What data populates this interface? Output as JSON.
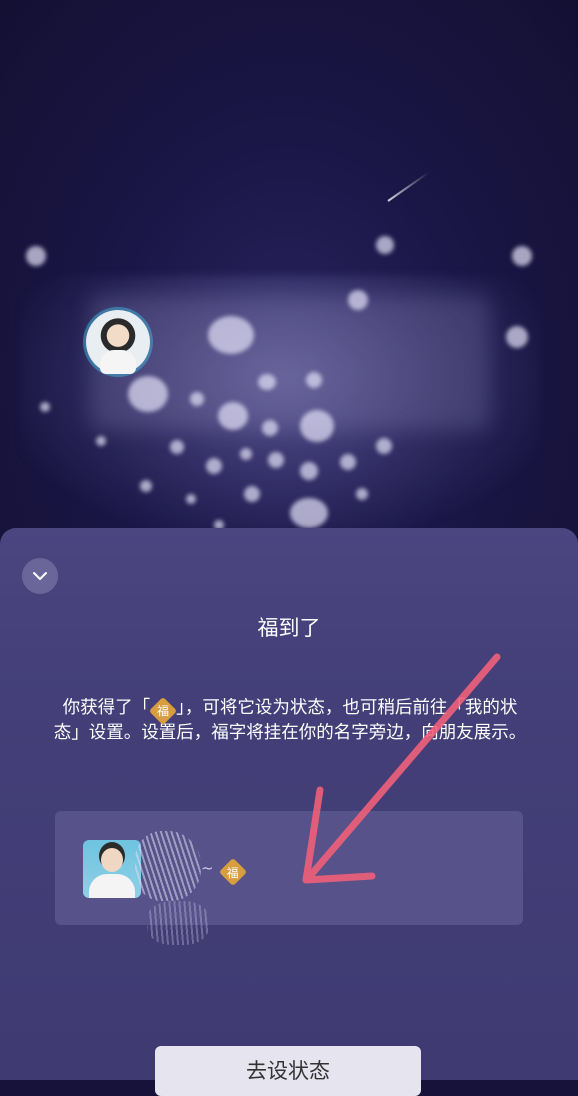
{
  "background": {
    "colors": {
      "sky": "#16123a",
      "sheet": "#443f78",
      "badge": "#d79d3e",
      "annotation_arrow": "#f0607a"
    }
  },
  "sheet": {
    "collapse_icon": "chevron-down-icon",
    "title": "福到了",
    "description": {
      "part1": "你获得了「",
      "badge": "福",
      "part2": "」，可将它设为状态，也可稍后前往「我的状态」设置。设置后，福字将挂在你的名字旁边，向朋友展示。"
    },
    "preview": {
      "separator": "~",
      "badge": "福"
    },
    "button_label": "去设状态"
  }
}
